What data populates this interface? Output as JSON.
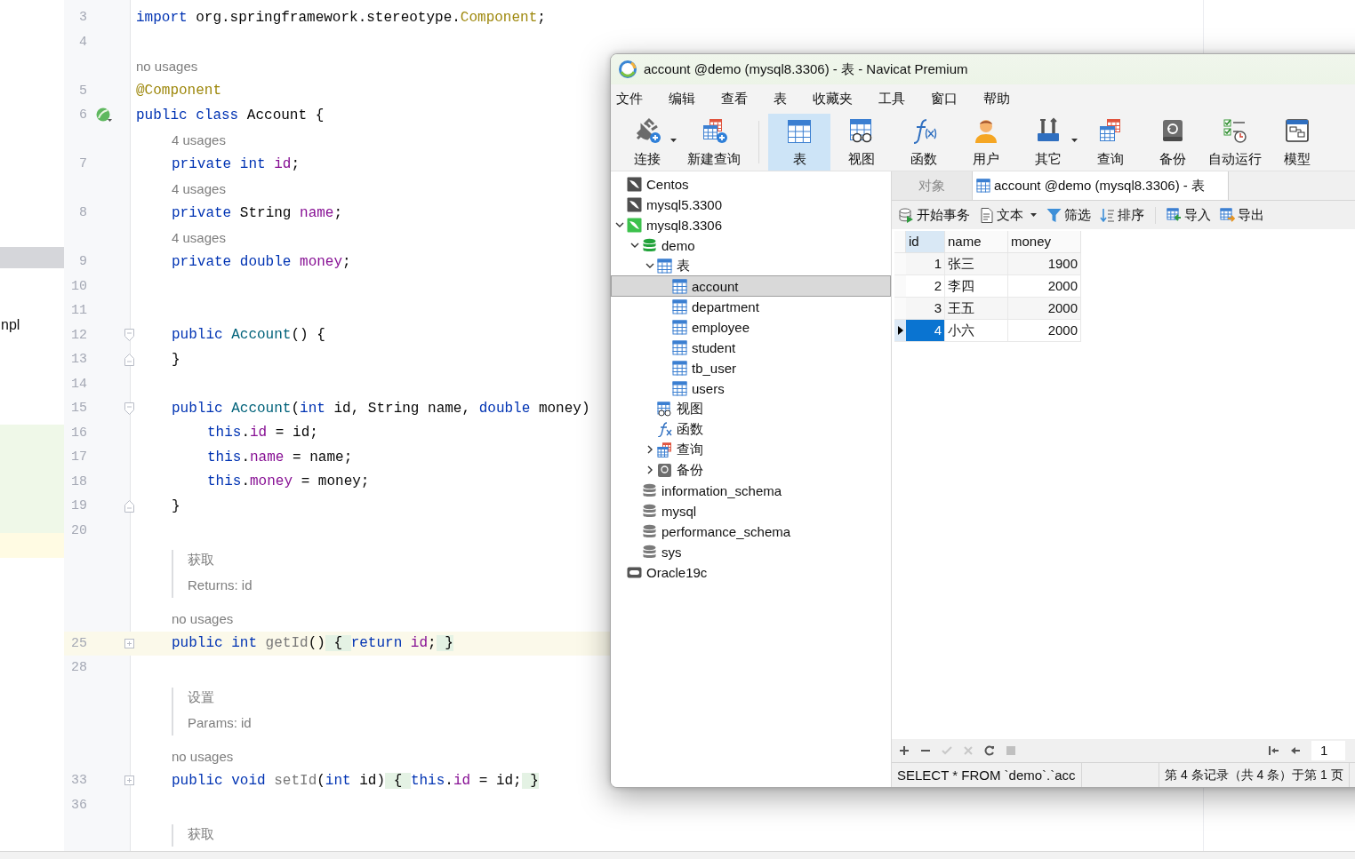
{
  "project_panel": {
    "items": [
      {
        "label": "npl"
      }
    ]
  },
  "editor": {
    "lines": [
      {
        "kind": "code",
        "number": "3",
        "tokens": [
          {
            "kind": "kw",
            "text": "import"
          },
          {
            "kind": "plain",
            "text": " org.springframework.stereotype."
          },
          {
            "kind": "ann",
            "text": "Component"
          },
          {
            "kind": "plain",
            "text": ";"
          }
        ]
      },
      {
        "kind": "code",
        "number": "4"
      },
      {
        "kind": "hint",
        "text": "no usages"
      },
      {
        "kind": "code",
        "number": "5",
        "tokens": [
          {
            "kind": "ann",
            "text": "@Component"
          }
        ]
      },
      {
        "kind": "code",
        "number": "6",
        "gutter": {
          "kind": "bean"
        },
        "tokens": [
          {
            "kind": "kw",
            "text": "public class"
          },
          {
            "kind": "plain",
            "text": " Account {"
          }
        ],
        "children": [
          {
            "kind": "hint",
            "text": "4 usages"
          },
          {
            "kind": "code",
            "number": "7",
            "tokens": [
              {
                "kind": "kw",
                "text": "private int"
              },
              {
                "kind": "field",
                "text": " id"
              },
              {
                "kind": "plain",
                "text": ";"
              }
            ]
          },
          {
            "kind": "hint",
            "text": "4 usages"
          },
          {
            "kind": "code",
            "number": "8",
            "tokens": [
              {
                "kind": "kw",
                "text": "private"
              },
              {
                "kind": "plain",
                "text": " String "
              },
              {
                "kind": "field",
                "text": "name"
              },
              {
                "kind": "plain",
                "text": ";"
              }
            ]
          },
          {
            "kind": "hint",
            "text": "4 usages"
          },
          {
            "kind": "code",
            "number": "9",
            "tokens": [
              {
                "kind": "kw",
                "text": "private double"
              },
              {
                "kind": "field",
                "text": " money"
              },
              {
                "kind": "plain",
                "text": ";"
              }
            ]
          },
          {
            "kind": "code",
            "number": "10"
          },
          {
            "kind": "code",
            "number": "11"
          },
          {
            "kind": "code",
            "number": "12",
            "fold": {
              "kind": "start"
            },
            "tokens": [
              {
                "kind": "kw",
                "text": "public"
              },
              {
                "kind": "decl",
                "text": " Account"
              },
              {
                "kind": "plain",
                "text": "() {"
              }
            ]
          },
          {
            "kind": "code",
            "number": "13",
            "fold": {
              "kind": "end"
            },
            "tokens": [
              {
                "kind": "plain",
                "text": "}"
              }
            ]
          },
          {
            "kind": "code",
            "number": "14"
          },
          {
            "kind": "code",
            "number": "15",
            "fold": {
              "kind": "start"
            },
            "tokens": [
              {
                "kind": "kw",
                "text": "public"
              },
              {
                "kind": "decl",
                "text": " Account"
              },
              {
                "kind": "plain",
                "text": "("
              },
              {
                "kind": "kw",
                "text": "int"
              },
              {
                "kind": "plain",
                "text": " id, String name, "
              },
              {
                "kind": "kw",
                "text": "double"
              },
              {
                "kind": "plain",
                "text": " money)"
              }
            ],
            "children": [
              {
                "kind": "code",
                "number": "16",
                "tokens": [
                  {
                    "kind": "kw",
                    "text": "this"
                  },
                  {
                    "kind": "plain",
                    "text": "."
                  },
                  {
                    "kind": "field",
                    "text": "id"
                  },
                  {
                    "kind": "plain",
                    "text": " = id;"
                  }
                ]
              },
              {
                "kind": "code",
                "number": "17",
                "tokens": [
                  {
                    "kind": "kw",
                    "text": "this"
                  },
                  {
                    "kind": "plain",
                    "text": "."
                  },
                  {
                    "kind": "field",
                    "text": "name"
                  },
                  {
                    "kind": "plain",
                    "text": " = name;"
                  }
                ]
              },
              {
                "kind": "code",
                "number": "18",
                "tokens": [
                  {
                    "kind": "kw",
                    "text": "this"
                  },
                  {
                    "kind": "plain",
                    "text": "."
                  },
                  {
                    "kind": "field",
                    "text": "money"
                  },
                  {
                    "kind": "plain",
                    "text": " = money;"
                  }
                ]
              }
            ]
          },
          {
            "kind": "code",
            "number": "19",
            "fold": {
              "kind": "end"
            },
            "tokens": [
              {
                "kind": "plain",
                "text": "}"
              }
            ]
          },
          {
            "kind": "code",
            "number": "20"
          },
          {
            "kind": "doc",
            "text": [
              "获取",
              "Returns: id"
            ]
          },
          {
            "kind": "hint",
            "text": "no usages"
          },
          {
            "kind": "code",
            "number": "25",
            "fold": {
              "kind": "collapsed"
            },
            "current": true,
            "tokens": [
              {
                "kind": "kw",
                "text": "public int"
              },
              {
                "kind": "muted",
                "text": " getId"
              },
              {
                "kind": "plain",
                "text": "()"
              },
              {
                "kind": "fold",
                "text": " { "
              },
              {
                "kind": "kw",
                "text": "return"
              },
              {
                "kind": "field",
                "text": " id"
              },
              {
                "kind": "plain",
                "text": ";"
              },
              {
                "kind": "fold",
                "text": " }"
              }
            ]
          },
          {
            "kind": "code",
            "number": "28"
          },
          {
            "kind": "doc",
            "text": [
              "设置",
              "Params: id"
            ]
          },
          {
            "kind": "hint",
            "text": "no usages"
          },
          {
            "kind": "code",
            "number": "33",
            "fold": {
              "kind": "collapsed"
            },
            "current": false,
            "tokens": [
              {
                "kind": "kw",
                "text": "public void"
              },
              {
                "kind": "muted",
                "text": " setId"
              },
              {
                "kind": "plain",
                "text": "("
              },
              {
                "kind": "kw",
                "text": "int"
              },
              {
                "kind": "plain",
                "text": " id)"
              },
              {
                "kind": "fold",
                "text": " { "
              },
              {
                "kind": "kw",
                "text": "this"
              },
              {
                "kind": "plain",
                "text": "."
              },
              {
                "kind": "field",
                "text": "id"
              },
              {
                "kind": "plain",
                "text": " = id;"
              },
              {
                "kind": "fold",
                "text": " }"
              }
            ]
          },
          {
            "kind": "code",
            "number": "36"
          },
          {
            "kind": "doc",
            "text": [
              "获取"
            ]
          }
        ]
      }
    ]
  },
  "navicat": {
    "title": "account @demo (mysql8.3306) - 表 - Navicat Premium",
    "menu": [
      "文件",
      "编辑",
      "查看",
      "表",
      "收藏夹",
      "工具",
      "窗口",
      "帮助"
    ],
    "toolbar": [
      {
        "label": "连接",
        "kind": "connect",
        "selected": false,
        "dropdown": true
      },
      {
        "label": "新建查询",
        "kind": "newquery",
        "selected": false,
        "dropdown": false
      },
      {
        "label": "表",
        "kind": "table",
        "selected": true,
        "dropdown": false
      },
      {
        "label": "视图",
        "kind": "view",
        "selected": false,
        "dropdown": false
      },
      {
        "label": "函数",
        "kind": "function",
        "selected": false,
        "dropdown": false
      },
      {
        "label": "用户",
        "kind": "user",
        "selected": false,
        "dropdown": false
      },
      {
        "label": "其它",
        "kind": "other",
        "selected": false,
        "dropdown": true
      },
      {
        "label": "查询",
        "kind": "query",
        "selected": false,
        "dropdown": false
      },
      {
        "label": "备份",
        "kind": "backup",
        "selected": false,
        "dropdown": false
      },
      {
        "label": "自动运行",
        "kind": "autorun",
        "selected": false,
        "dropdown": false
      },
      {
        "label": "模型",
        "kind": "model",
        "selected": false,
        "dropdown": false
      }
    ],
    "tree": [
      {
        "label": "Centos",
        "kind": "connection",
        "open": false,
        "selected": false
      },
      {
        "label": "mysql5.3300",
        "kind": "connection",
        "open": false,
        "selected": false
      },
      {
        "label": "mysql8.3306",
        "kind": "connection",
        "open": true,
        "selected": false,
        "expanded": true,
        "children": [
          {
            "label": "demo",
            "kind": "database",
            "open": true,
            "selected": false,
            "expanded": true,
            "children": [
              {
                "label": "表",
                "kind": "tables",
                "selected": false,
                "expanded": true,
                "children": [
                  {
                    "label": "account",
                    "kind": "table",
                    "selected": true
                  },
                  {
                    "label": "department",
                    "kind": "table",
                    "selected": false
                  },
                  {
                    "label": "employee",
                    "kind": "table",
                    "selected": false
                  },
                  {
                    "label": "student",
                    "kind": "table",
                    "selected": false
                  },
                  {
                    "label": "tb_user",
                    "kind": "table",
                    "selected": false
                  },
                  {
                    "label": "users",
                    "kind": "table",
                    "selected": false
                  }
                ]
              },
              {
                "label": "视图",
                "kind": "views",
                "selected": false
              },
              {
                "label": "函数",
                "kind": "functions",
                "selected": false
              },
              {
                "label": "查询",
                "kind": "queries",
                "selected": false,
                "expanded": false
              },
              {
                "label": "备份",
                "kind": "backups",
                "selected": false,
                "expanded": false
              }
            ]
          },
          {
            "label": "information_schema",
            "kind": "database",
            "open": false,
            "selected": false
          },
          {
            "label": "mysql",
            "kind": "database",
            "open": false,
            "selected": false
          },
          {
            "label": "performance_schema",
            "kind": "database",
            "open": false,
            "selected": false
          },
          {
            "label": "sys",
            "kind": "database",
            "open": false,
            "selected": false
          }
        ]
      },
      {
        "label": "Oracle19c",
        "kind": "oracle",
        "selected": false
      }
    ],
    "tabs": [
      {
        "label": "对象",
        "selected": false
      },
      {
        "label": "account @demo (mysql8.3306) - 表",
        "selected": true
      }
    ],
    "table_toolbar": [
      [
        {
          "label": "开始事务",
          "kind": "transaction",
          "dropdown": false
        },
        {
          "label": "文本",
          "kind": "text",
          "dropdown": true
        },
        {
          "label": "筛选",
          "kind": "filter",
          "dropdown": false
        },
        {
          "label": "排序",
          "kind": "sort",
          "dropdown": false
        }
      ],
      [
        {
          "label": "导入",
          "kind": "import",
          "dropdown": false
        },
        {
          "label": "导出",
          "kind": "export",
          "dropdown": false
        }
      ]
    ],
    "grid": {
      "columns": [
        {
          "label": "id",
          "selected": true,
          "kind": "number"
        },
        {
          "label": "name",
          "selected": false,
          "kind": "text"
        },
        {
          "label": "money",
          "selected": false,
          "kind": "number"
        }
      ],
      "rows": [
        {
          "cells": [
            "1",
            "张三",
            "1900"
          ],
          "selected": false
        },
        {
          "cells": [
            "2",
            "李四",
            "2000"
          ],
          "selected": false
        },
        {
          "cells": [
            "3",
            "王五",
            "2000"
          ],
          "selected": false
        },
        {
          "cells": [
            "4",
            "小六",
            "2000"
          ],
          "selected": true
        }
      ]
    },
    "page": "1",
    "status": {
      "sql": "SELECT * FROM `demo`.`acc",
      "records": "第 4 条记录（共 4 条）于第 1 页"
    }
  }
}
